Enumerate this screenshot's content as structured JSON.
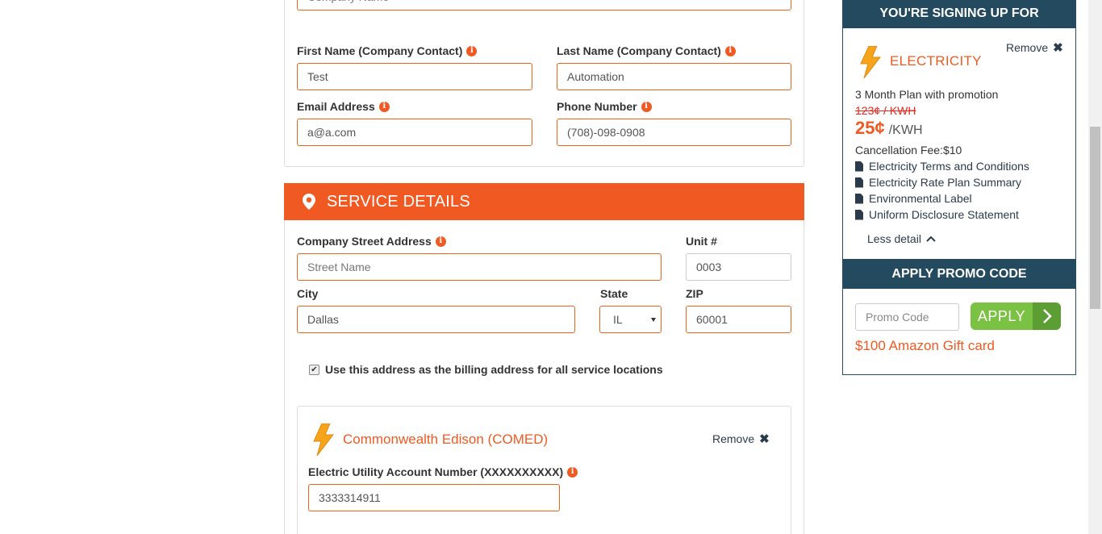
{
  "contact": {
    "company_name_placeholder": "Company Name",
    "first_name_label": "First Name (Company Contact)",
    "first_name_value": "Test",
    "last_name_label": "Last Name (Company Contact)",
    "last_name_value": "Automation",
    "email_label": "Email Address",
    "email_value": "a@a.com",
    "phone_label": "Phone Number",
    "phone_value": "(708)-098-0908"
  },
  "service": {
    "header": "SERVICE DETAILS",
    "street_label": "Company Street Address",
    "street_placeholder": "Street Name",
    "unit_label": "Unit #",
    "unit_value": "0003",
    "city_label": "City",
    "city_value": "Dallas",
    "state_label": "State",
    "state_value": "IL",
    "zip_label": "ZIP",
    "zip_value": "60001",
    "billing_checkbox_label": "Use this address as the billing address for all service locations",
    "billing_checked": true
  },
  "utility": {
    "name": "Commonwealth Edison (COMED)",
    "remove_label": "Remove",
    "account_label": "Electric Utility Account Number (XXXXXXXXXX)",
    "account_value": "3333314911"
  },
  "sidebar": {
    "header": "YOU'RE SIGNING UP FOR",
    "remove_label": "Remove",
    "product": "ELECTRICITY",
    "plan": "3 Month Plan with promotion",
    "old_price": "123¢ / KWH",
    "price": "25¢",
    "price_unit": "/KWH",
    "cancellation": "Cancellation Fee:$10",
    "documents": [
      "Electricity Terms and Conditions",
      "Electricity Rate Plan Summary",
      "Environmental Label",
      "Uniform Disclosure Statement"
    ],
    "less_detail": "Less detail",
    "promo_header": "APPLY PROMO CODE",
    "promo_placeholder": "Promo Code",
    "apply_label": "APPLY",
    "gift": "$100 Amazon Gift card"
  },
  "colors": {
    "accent": "#f05a22",
    "navy": "#244a60",
    "apply_green": "#7bc143"
  }
}
